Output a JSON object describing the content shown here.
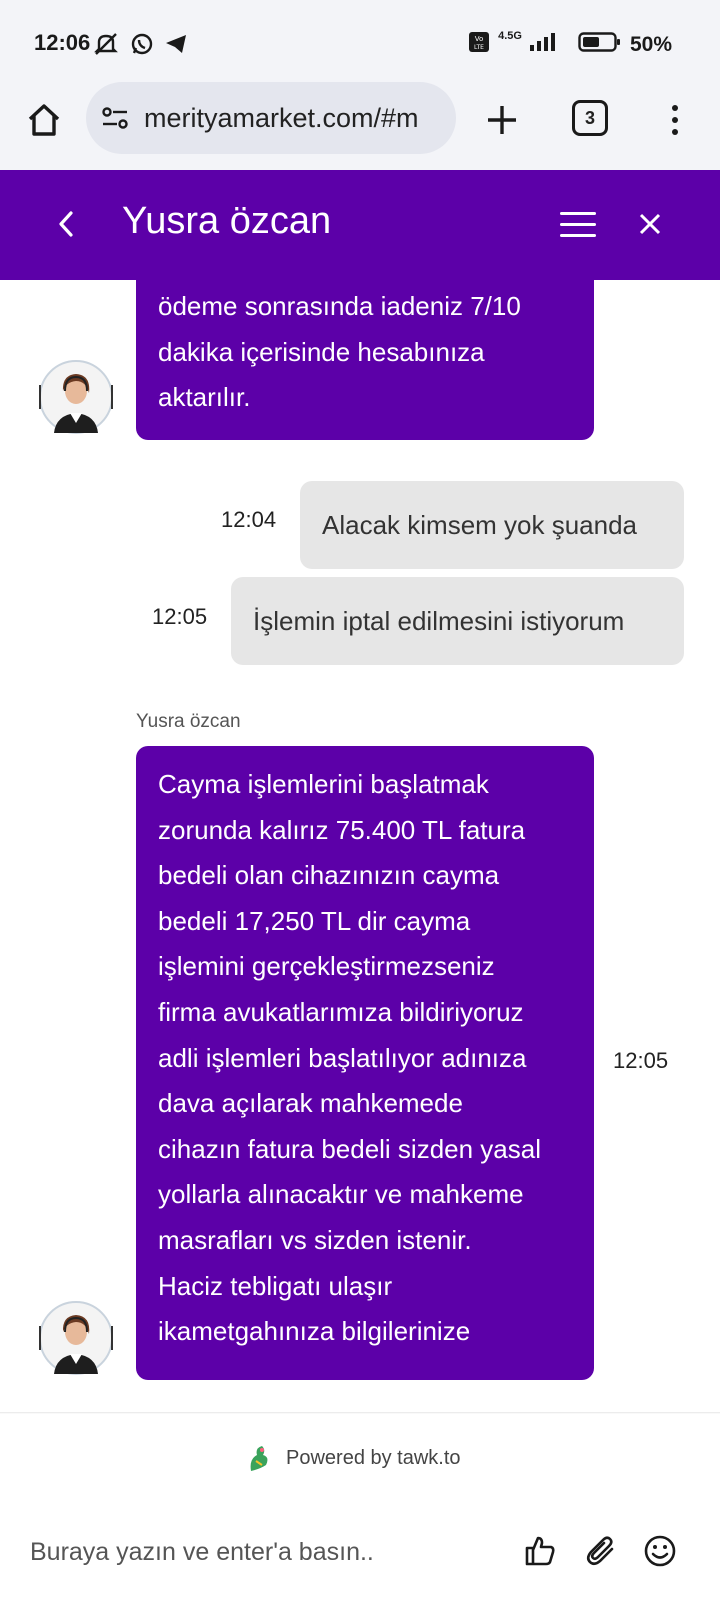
{
  "status_bar": {
    "time": "12:06",
    "battery_text": "50%",
    "network_label": "4.5G"
  },
  "browser": {
    "url": "merityamarket.com/#m",
    "tab_count": "3"
  },
  "chat_header": {
    "title": "Yusra özcan"
  },
  "messages": {
    "agent_1": {
      "lines": [
        "ödeme sonrasında iadeniz 7/10",
        "dakika içerisinde hesabınıza",
        "aktarılır."
      ]
    },
    "user_1": {
      "text": "Alacak kimsem yok şuanda",
      "time": "12:04"
    },
    "user_2": {
      "text": "İşlemin iptal edilmesini istiyorum",
      "time": "12:05"
    },
    "agent_2": {
      "sender": "Yusra özcan",
      "time": "12:05",
      "lines": [
        "Cayma işlemlerini başlatmak",
        "zorunda kalırız 75.400 TL fatura",
        "bedeli olan cihazınızın cayma",
        "bedeli 17,250 TL dir cayma",
        "işlemini gerçekleştirmezseniz",
        "firma avukatlarımıza bildiriyoruz",
        "adli işlemleri başlatılıyor adınıza",
        "dava açılarak mahkemede",
        "cihazın fatura bedeli sizden yasal",
        "yollarla alınacaktır ve mahkeme",
        "masrafları vs sizden istenir.",
        "Haciz tebligatı ulaşır",
        "ikametgahınıza bilgilerinize"
      ]
    }
  },
  "footer": {
    "powered_by": "Powered by tawk.to",
    "input_placeholder": "Buraya yazın ve enter'a basın.."
  },
  "colors": {
    "brand_purple": "#5c00a8",
    "user_bubble": "#e6e6e6"
  },
  "icons": [
    "home-icon",
    "site-settings-icon",
    "plus-icon",
    "tab-switcher-icon",
    "more-vert-icon",
    "back-chevron-icon",
    "hamburger-icon",
    "close-icon",
    "tawk-logo-icon",
    "thumbs-up-icon",
    "paperclip-icon",
    "emoji-icon"
  ]
}
